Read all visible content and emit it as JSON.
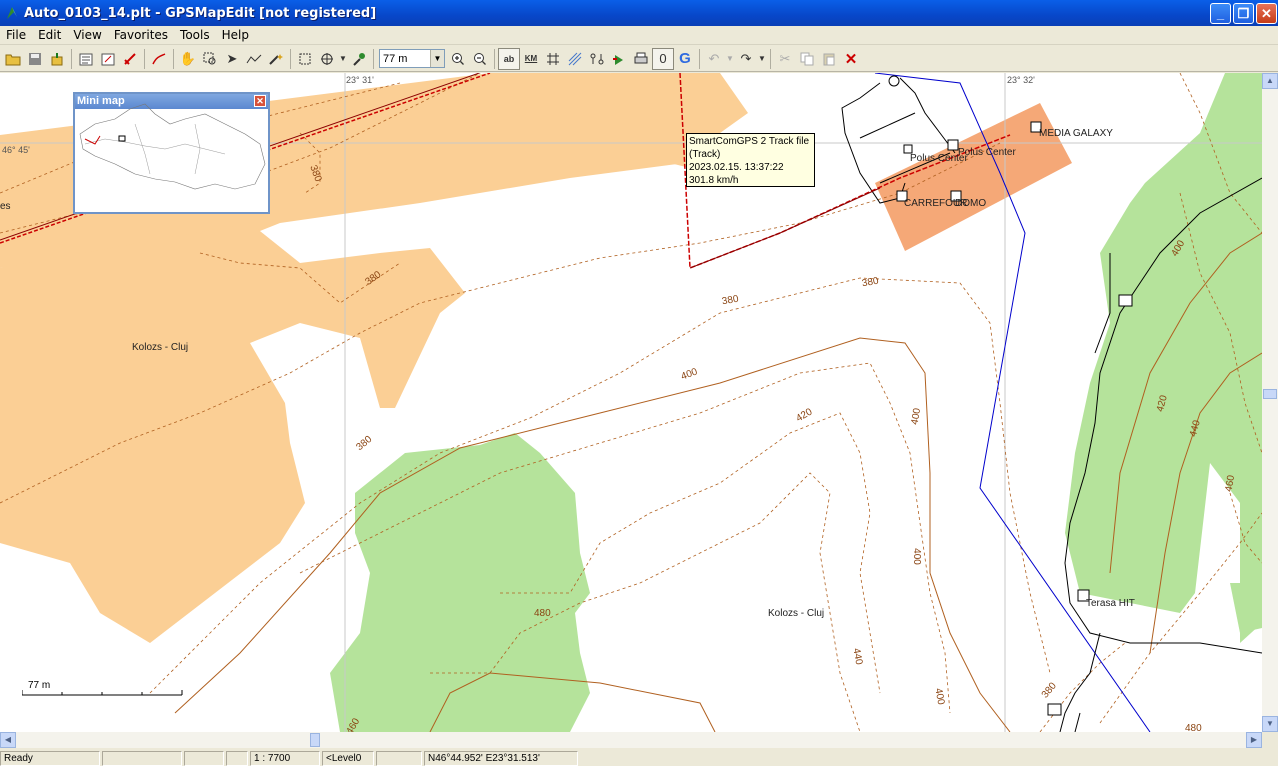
{
  "window": {
    "title": "Auto_0103_14.plt - GPSMapEdit [not registered]",
    "minimize_glyph": "_",
    "maximize_glyph": "❐",
    "close_glyph": "✕"
  },
  "menu": [
    "File",
    "Edit",
    "View",
    "Favorites",
    "Tools",
    "Help"
  ],
  "toolbar": {
    "zoom_value": "77 m",
    "icons": [
      "open-icon",
      "save-icon",
      "export-icon",
      "properties-icon",
      "transform-icon",
      "gpsbabel-icon",
      "track-icon",
      "hand-icon",
      "zoom-rect-icon",
      "select-icon",
      "polyline-icon",
      "magic-icon",
      "crop-icon",
      "node-icon",
      "pin-icon",
      "zoom-in-icon",
      "zoom-out-icon",
      "labels-icon",
      "km-icon",
      "grid-icon",
      "hatch-icon",
      "waypoints-icon",
      "gps-icon",
      "print-icon",
      "attach-icon",
      "google-icon",
      "undo-icon",
      "redo-icon",
      "cut-icon",
      "copy-icon",
      "paste-icon",
      "delete-icon"
    ],
    "labels_btn": "ab",
    "km_btn": "KM",
    "google_btn": "G"
  },
  "minimap": {
    "title": "Mini map",
    "close_glyph": "✕"
  },
  "tooltip": {
    "line1": "SmartComGPS 2 Track file",
    "line2": "(Track)",
    "line3": "2023.02.15. 13:37:22",
    "line4": "301.8 km/h"
  },
  "map": {
    "grid_labels": {
      "lon1": "23° 31'",
      "lon2": "23° 32'",
      "lat1": "46° 45'"
    },
    "places": {
      "city1": "Kolozs - Cluj",
      "city2": "Kolozs - Cluj",
      "poi1": "MEDIA GALAXY",
      "poi2": "Polus Center",
      "poi3": "Polus Center",
      "poi4": "CARREFOUR",
      "poi5": "DOMO",
      "poi6": "Terasa HIT",
      "edge": "es"
    },
    "contours": [
      "380",
      "380",
      "380",
      "380",
      "380",
      "400",
      "420",
      "400",
      "400",
      "440",
      "480",
      "460",
      "400",
      "420",
      "440",
      "460",
      "480",
      "380",
      "400"
    ],
    "scale_label": "77 m",
    "colors": {
      "urban": "#FBCF95",
      "forest": "#B5E39B",
      "commercial": "#F5A877",
      "track": "#CC0000",
      "contour": "#B06020",
      "road_blue": "#0000CC"
    }
  },
  "status": {
    "state": "Ready",
    "scale": "1 : 7700",
    "level": "<Level0",
    "coords": "N46°44.952' E23°31.513'"
  }
}
